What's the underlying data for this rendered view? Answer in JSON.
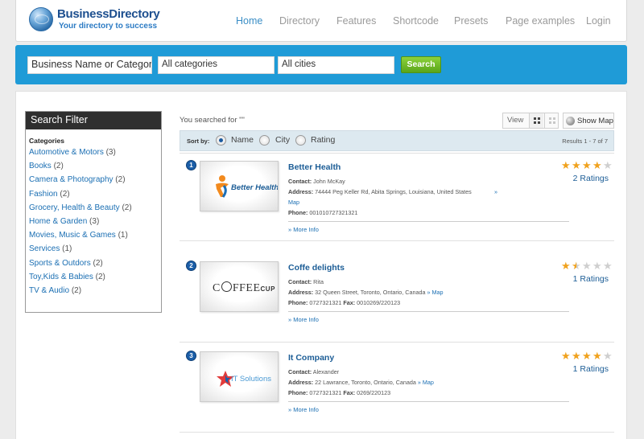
{
  "brand": {
    "name": "BusinessDirectory",
    "tagline": "Your directory to success"
  },
  "nav": [
    "Home",
    "Directory",
    "Features",
    "Shortcode",
    "Presets",
    "Page examples",
    "Login"
  ],
  "search": {
    "name_value": "Business Name or Category",
    "category_value": "All categories",
    "city_value": "All cities",
    "button_label": "Search"
  },
  "filter": {
    "title": "Search Filter",
    "categories_label": "Categories",
    "items": [
      {
        "name": "Automotive & Motors",
        "count": "(3)"
      },
      {
        "name": "Books",
        "count": "(2)"
      },
      {
        "name": "Camera & Photography",
        "count": "(2)"
      },
      {
        "name": "Fashion",
        "count": "(2)"
      },
      {
        "name": "Grocery, Health & Beauty",
        "count": "(2)"
      },
      {
        "name": "Home & Garden",
        "count": "(3)"
      },
      {
        "name": "Movies, Music & Games",
        "count": "(1)"
      },
      {
        "name": "Services",
        "count": "(1)"
      },
      {
        "name": "Sports & Outdors",
        "count": "(2)"
      },
      {
        "name": "Toy,Kids & Babies",
        "count": "(2)"
      },
      {
        "name": "TV & Audio",
        "count": "(2)"
      }
    ]
  },
  "results": {
    "searched_text": "You searched for \"\"",
    "view_label": "View",
    "show_map_label": "Show Map",
    "sort": {
      "label": "Sort by:",
      "options": [
        "Name",
        "City",
        "Rating"
      ],
      "selected": "Name"
    },
    "count_text": "Results 1 - 7 of 7",
    "more_info_label": "» More Info",
    "listings": [
      {
        "index": "1",
        "name": "Better Health",
        "contact_label": "Contact:",
        "contact": "John McKay",
        "address_label": "Address:",
        "address": "74444 Peg Keller Rd, Abita Springs, Louisiana, United States",
        "map_label": "» Map",
        "phone_label": "Phone:",
        "phone": "001010727321321",
        "fax_label": "",
        "fax": "",
        "rating_stars": 4,
        "ratings_text": "2 Ratings",
        "logo": "Better Health"
      },
      {
        "index": "2",
        "name": "Coffe delights",
        "contact_label": "Contact:",
        "contact": "Rita",
        "address_label": "Address:",
        "address": "32 Queen Street, Toronto, Ontario, Canada",
        "map_label": "» Map",
        "phone_label": "Phone:",
        "phone": "0727321321",
        "fax_label": "Fax:",
        "fax": "0010269/220123",
        "rating_stars": 1.5,
        "ratings_text": "1 Ratings",
        "logo": "C",
        "logo_mid": "FFEE",
        "logo_small": "CUP"
      },
      {
        "index": "3",
        "name": "It Company",
        "contact_label": "Contact:",
        "contact": "Alexander",
        "address_label": "Address:",
        "address": "22 Lawrance, Toronto, Ontario, Canada",
        "map_label": "» Map",
        "phone_label": "Phone:",
        "phone": "0727321321",
        "fax_label": "Fax:",
        "fax": "0269/220123",
        "rating_stars": 4,
        "ratings_text": "1 Ratings",
        "logo": "IT Solutions"
      }
    ]
  },
  "colors": {
    "accent": "#1f9bd7",
    "link": "#1b6fb3",
    "star": "#f0a21e",
    "button": "#6cbb24",
    "badge": "#1b5ea8"
  }
}
